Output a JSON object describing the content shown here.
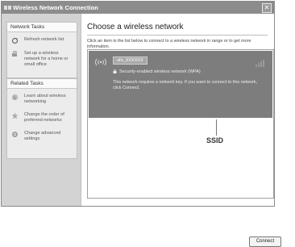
{
  "window": {
    "title": "Wireless Network Connection",
    "close_glyph": "✕"
  },
  "sidebar": {
    "network_tasks": {
      "header": "Network Tasks",
      "items": [
        {
          "label": "Refresh network list",
          "icon": "refresh-icon"
        },
        {
          "label": "Set up a wireless network for a home or small office",
          "icon": "setup-network-icon"
        }
      ]
    },
    "related_tasks": {
      "header": "Related Tasks",
      "items": [
        {
          "label": "Learn about wireless networking",
          "icon": "info-icon"
        },
        {
          "label": "Change the order of preferred networks",
          "icon": "star-icon"
        },
        {
          "label": "Change advanced settings",
          "icon": "settings-icon"
        }
      ]
    }
  },
  "main": {
    "heading": "Choose a wireless network",
    "instruction": "Click an item in the list below to connect to a wireless network in range or to get more information.",
    "network": {
      "ssid": "ufo_XXXXXX",
      "security": "Security-enabled wireless network (WPA)",
      "note": "This network requires a network key. If you want to connect to this network, click Connect.",
      "signal_glyph": "((•))"
    },
    "callout_label": "SSID",
    "connect_label": "Connect"
  },
  "colors": {
    "titlebar": "#8c8c8c",
    "sidebar": "#d3d3d3",
    "selected_row": "#7d7d7d"
  }
}
